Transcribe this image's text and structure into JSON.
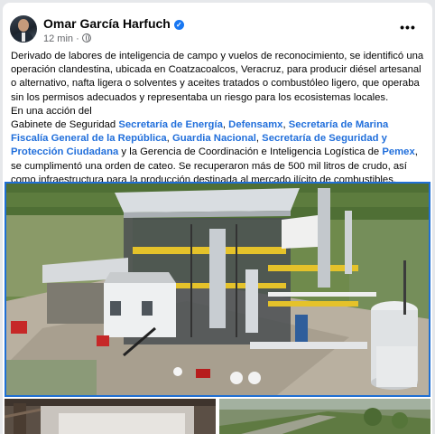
{
  "post": {
    "author": "Omar García Harfuch",
    "time": "12 min",
    "meta_separator": "·",
    "more_label": "•••",
    "paragraph1": "Derivado de labores de inteligencia de campo y vuelos de reconocimiento, se identificó una operación clandestina, ubicada en Coatzacoalcos, Veracruz, para producir diésel artesanal o alternativo, nafta ligera o solventes y aceites tratados o combustóleo ligero, que operaba sin los permisos adecuados y representaba un riesgo para los ecosistemas locales.",
    "intro": "En una acción del",
    "gabinete": "Gabinete de Seguridad",
    "link_energia": "Secretaría de Energía",
    "link_defensa": "Defensamx",
    "link_marina": "Secretaría de Marina",
    "link_fiscalia": "Fiscalía General de la República",
    "link_guardia": "Guardia Nacional",
    "link_sspc": "Secretaría de Seguridad y Protección Ciudadana",
    "mid_text": "y la Gerencia de Coordinación e Inteligencia Logística de",
    "link_pemex": "Pemex",
    "end_text": ", se cumplimentó una orden de cateo. Se recuperaron más de 500 mil litros de crudo, así como infraestructura para la producción destinada al mercado ilícito de combustibles.",
    "sep_comma": ",",
    "sep_space": " "
  },
  "icons": {
    "verified": "verified-badge-icon",
    "privacy": "globe-icon",
    "more": "more-options-icon"
  },
  "colors": {
    "link": "#216fdb",
    "selection_border": "#1f6fd4",
    "verified": "#1877f2"
  }
}
